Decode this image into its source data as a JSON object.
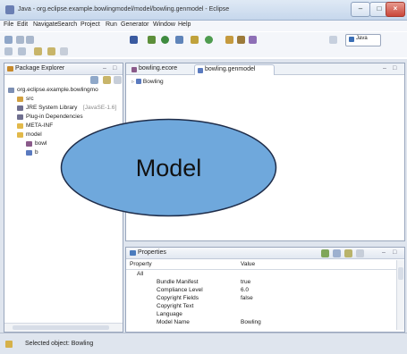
{
  "window": {
    "title": "Java - org.eclipse.example.bowlingmodel/model/bowling.genmodel - Eclipse"
  },
  "menubar": {
    "items": [
      "File",
      "Edit",
      "Navigate",
      "Search",
      "Project",
      "Run",
      "Generator",
      "Window",
      "Help"
    ]
  },
  "toolbar": {
    "perspective_label": "Java"
  },
  "package_explorer": {
    "title": "Package Explorer",
    "tree": [
      {
        "label": "org.eclipse.example.bowlingmo",
        "icon": "project-icon"
      },
      {
        "label": "src",
        "icon": "source-folder-icon"
      },
      {
        "label": "JRE System Library",
        "suffix": "[JavaSE-1.6]",
        "icon": "library-icon"
      },
      {
        "label": "Plug-in Dependencies",
        "icon": "library-icon"
      },
      {
        "label": "META-INF",
        "icon": "folder-icon"
      },
      {
        "label": "model",
        "icon": "folder-icon"
      },
      {
        "label": "bowl",
        "icon": "ecore-file-icon"
      },
      {
        "label": "b",
        "icon": "genmodel-file-icon"
      }
    ]
  },
  "editor": {
    "tabs": [
      {
        "label": "bowling.ecore",
        "icon": "ecore-file-icon"
      },
      {
        "label": "bowling.genmodel",
        "icon": "genmodel-file-icon"
      }
    ],
    "tree_root": "Bowling"
  },
  "properties": {
    "title": "Properties",
    "columns": [
      "Property",
      "Value"
    ],
    "category": "All",
    "rows": [
      {
        "key": "Bundle Manifest",
        "value": "true"
      },
      {
        "key": "Compliance Level",
        "value": "6.0"
      },
      {
        "key": "Copyright Fields",
        "value": "false"
      },
      {
        "key": "Copyright Text",
        "value": ""
      },
      {
        "key": "Language",
        "value": ""
      },
      {
        "key": "Model Name",
        "value": "Bowling"
      }
    ]
  },
  "status": {
    "text": "Selected object: Bowling"
  },
  "overlay": {
    "label": "Model",
    "fill": "#6fa8dc",
    "stroke": "#1f2d4a"
  }
}
